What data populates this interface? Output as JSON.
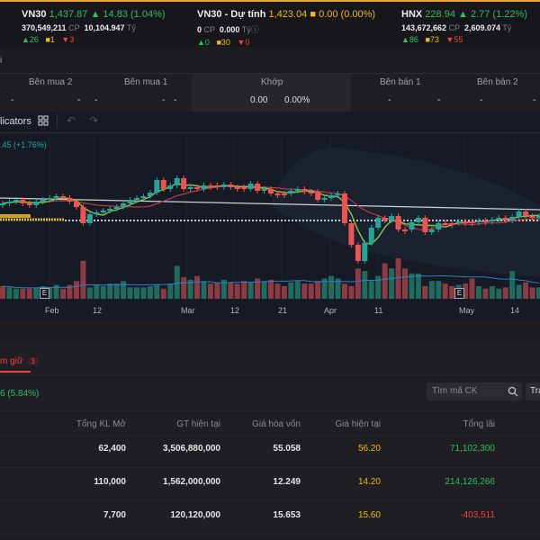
{
  "indices": [
    {
      "name": "VN30",
      "value": "1,437.87",
      "change": "▲ 14.83 (1.04%)",
      "volume": "370,549,211",
      "vol_unit": "CP",
      "amount": "10,104.947",
      "amt_unit": "Tỷ",
      "up": "▲26",
      "same": "■1",
      "down": "▼3",
      "color": "#2ebd65"
    },
    {
      "name": "VN30 - Dự tính",
      "value": "1,423.04",
      "change": "■ 0.00 (0.00%)",
      "volume": "0",
      "vol_unit": "CP",
      "amount": "0.000",
      "amt_unit": "Tỷⓘ",
      "up": "▲0",
      "same": "■30",
      "down": "▼0",
      "color": "#f0b90b"
    },
    {
      "name": "HNX",
      "value": "228.94",
      "change": "▲ 2.77 (1.22%)",
      "volume": "143,672,662",
      "vol_unit": "CP",
      "amount": "2,609.074",
      "amt_unit": "Tỷ",
      "up": "▲86",
      "same": "■73",
      "down": "▼55",
      "color": "#2ebd65"
    }
  ],
  "row2_label": "i",
  "orderbook": {
    "headers": [
      "Bên mua 2",
      "Bên mua 1",
      "Khớp",
      "Bên bán 1",
      "Bên bán 2"
    ],
    "dash": "-",
    "match_price": "0.00",
    "match_pct": "0.00%"
  },
  "toolbar": {
    "indicators": "licators",
    "layout_icon": "grid-icon",
    "undo": "↶",
    "redo": "↷"
  },
  "chart": {
    "legend": ".45 (+1.76%)",
    "x_labels": [
      "Feb",
      "12",
      "Mar",
      "12",
      "21",
      "Apr",
      "11",
      "May",
      "14"
    ],
    "event_marker": "E",
    "closes": [
      226,
      224,
      222,
      226,
      228,
      224,
      222,
      220,
      218,
      220,
      224,
      230,
      248,
      238,
      236,
      234,
      232,
      230,
      226,
      222,
      220,
      218,
      214,
      200,
      210,
      206,
      198,
      210,
      208,
      210,
      206,
      206,
      208,
      205,
      208,
      208,
      210,
      204,
      212,
      210,
      215,
      215,
      215,
      212,
      210,
      213,
      213,
      222,
      220,
      217,
      215,
      248,
      272,
      290,
      270,
      253,
      242,
      245,
      240,
      255,
      255,
      247,
      242,
      258,
      255,
      248,
      248,
      248,
      246,
      246,
      247,
      245,
      245,
      244,
      242,
      245,
      241,
      235,
      240,
      242,
      240
    ],
    "volumes": [
      10,
      9,
      8,
      8,
      8,
      9,
      10,
      9,
      11,
      8,
      11,
      14,
      30,
      9,
      11,
      10,
      12,
      12,
      14,
      9,
      9,
      9,
      10,
      11,
      8,
      12,
      26,
      17,
      15,
      18,
      14,
      12,
      13,
      15,
      13,
      12,
      14,
      13,
      16,
      14,
      15,
      12,
      10,
      13,
      14,
      12,
      12,
      14,
      16,
      18,
      16,
      12,
      10,
      24,
      22,
      14,
      18,
      28,
      24,
      32,
      24,
      20,
      20,
      10,
      14,
      14,
      12,
      10,
      11,
      12,
      16,
      10,
      8,
      10,
      8,
      9,
      22,
      11,
      13,
      9,
      9
    ]
  },
  "bottom": {
    "tab": "m giữ",
    "tab_count": "3",
    "summary": "6 (5.84%)",
    "search_placeholder": "Tìm mã CK",
    "trade_button": "Tra",
    "columns": [
      "Tổng KL Mở",
      "GT hiện tại",
      "Giá hòa vốn",
      "Giá hiện tại",
      "Tổng lãi"
    ],
    "rows": [
      [
        "62,400",
        "3,506,880,000",
        "55.058",
        "56.20",
        "71,102,300"
      ],
      [
        "110,000",
        "1,562,000,000",
        "12.249",
        "14.20",
        "214,126,266"
      ],
      [
        "7,700",
        "120,120,000",
        "15.653",
        "15.60",
        "-403,511"
      ]
    ]
  }
}
